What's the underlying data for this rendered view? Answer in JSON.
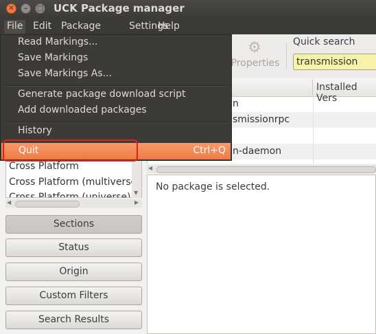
{
  "window": {
    "title": "UCK Package manager",
    "close_glyph": "✕",
    "minimize_glyph": "–",
    "maximize_glyph": "□"
  },
  "menubar": {
    "items": [
      "File",
      "Edit",
      "Package",
      "Settings",
      "Help"
    ]
  },
  "file_menu": {
    "items": [
      "Read Markings...",
      "Save Markings",
      "Save Markings As...",
      "Generate package download script",
      "Add downloaded packages",
      "History"
    ],
    "quit": {
      "label": "Quit",
      "accelerator": "Ctrl+Q"
    }
  },
  "toolbar": {
    "properties_label": "Properties",
    "properties_icon": "gear-icon"
  },
  "quick_search": {
    "label": "Quick search",
    "value": "transmission"
  },
  "package_table": {
    "columns": [
      "Installed Vers"
    ],
    "rows": [
      {
        "name_visible": "n"
      },
      {
        "name_visible": "smissionrpc"
      },
      {
        "name_visible": ""
      },
      {
        "name_visible": "n-daemon"
      }
    ]
  },
  "detail": {
    "text": "No package is selected."
  },
  "section_list": {
    "items": [
      "Cross Platform",
      "Cross Platform (multiverse",
      "Cross Platform (universe)"
    ]
  },
  "filter_buttons": [
    "Sections",
    "Status",
    "Origin",
    "Custom Filters",
    "Search Results"
  ],
  "colors": {
    "highlight": "#ef7b40",
    "menubar": "#3c3b37",
    "search_bg": "#f7f3a8",
    "annotation": "#e0201a"
  }
}
